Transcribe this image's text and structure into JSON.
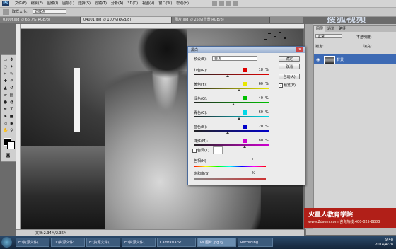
{
  "app": {
    "logo": "Ps"
  },
  "menu": [
    "文件(F)",
    "编辑(E)",
    "图像(I)",
    "图层(L)",
    "选择(S)",
    "滤镜(T)",
    "分析(A)",
    "3D(D)",
    "视图(V)",
    "窗口(W)",
    "帮助(H)"
  ],
  "top_watermark": "搜狐视频",
  "options_bar": {
    "sample_size_label": "取样大小:",
    "sample_size_value": "取样点"
  },
  "tabs": [
    {
      "label": "0300f.jpg @ 66.7%(RGB/8)",
      "active": false
    },
    {
      "label": "04001.jpg @ 100%(RGB/8)",
      "active": true
    },
    {
      "label": "图片.jpg @ 25%(背景,RGB/8)",
      "active": false
    }
  ],
  "status": {
    "text": "文档:2.34M/2.36M"
  },
  "layers_panel": {
    "tabs": [
      "图层",
      "通道",
      "路径"
    ],
    "blend_mode": "正常",
    "opacity_label": "不透明度:",
    "lock_label": "锁定:",
    "fill_label": "填充:",
    "layer_name": "背景"
  },
  "dialog": {
    "title": "黑白",
    "preset_label": "预设(E):",
    "preset_value": "自定",
    "buttons": {
      "ok": "确定",
      "cancel": "取消",
      "auto": "自动(A)"
    },
    "preview_label": "预览(P)",
    "sliders": [
      {
        "label": "红色(R):",
        "value": "18",
        "swatch": "#e00000",
        "track_to": "#e00000",
        "pos": 0.45
      },
      {
        "label": "黄色(Y):",
        "value": "60",
        "swatch": "#e8e800",
        "track_to": "#e8e800",
        "pos": 0.6
      },
      {
        "label": "绿色(G):",
        "value": "40",
        "swatch": "#00c000",
        "track_to": "#00c000",
        "pos": 0.52
      },
      {
        "label": "青色(C):",
        "value": "60",
        "swatch": "#00d8e8",
        "track_to": "#00d8e8",
        "pos": 0.6
      },
      {
        "label": "蓝色(B):",
        "value": "20",
        "swatch": "#0000c8",
        "track_to": "#0000c8",
        "pos": 0.45
      },
      {
        "label": "洋红(M):",
        "value": "80",
        "swatch": "#d000d0",
        "track_to": "#d000d0",
        "pos": 0.67
      }
    ],
    "tint_label": "色调(T)",
    "hue_label": "色相(H)",
    "saturation_label": "饱和度(S)",
    "percent": "%",
    "degree": "°"
  },
  "promo": {
    "title": "火星人教育学院",
    "line": "www.2dsem.com 咨询热线:400-025-8883"
  },
  "taskbar": {
    "items": [
      "E:\\资源文件\\...",
      "D:\\资源文件\\...",
      "E:\\资源文件\\...",
      "E:\\资源文件\\...",
      "Camtasia St...",
      "Ps 图片.jpg @...",
      "Recording..."
    ],
    "active_index": 5,
    "time": "9:48",
    "date": "2014/4/28"
  }
}
